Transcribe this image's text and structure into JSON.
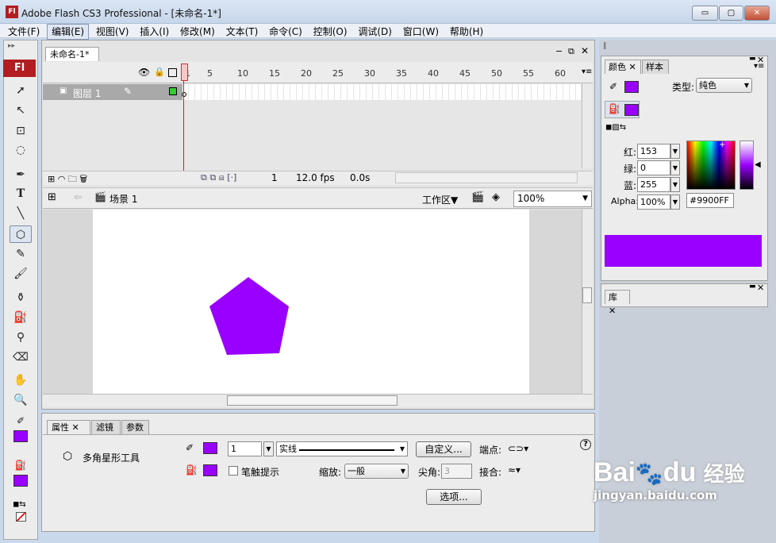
{
  "window": {
    "logo": "Fl",
    "title": "Adobe Flash CS3 Professional - [未命名-1*]",
    "min": "▭",
    "max": "▢",
    "close": "✕"
  },
  "menu": [
    "文件(F)",
    "编辑(E)",
    "视图(V)",
    "插入(I)",
    "修改(M)",
    "文本(T)",
    "命令(C)",
    "控制(O)",
    "调试(D)",
    "窗口(W)",
    "帮助(H)"
  ],
  "tools": {
    "logo": "Fl",
    "fill_color": "#9900ff",
    "stroke_color": "#9900ff"
  },
  "document": {
    "tab": "未命名-1*",
    "frame_numbers": [
      "1",
      "5",
      "10",
      "15",
      "20",
      "25",
      "30",
      "35",
      "40",
      "45",
      "50",
      "55",
      "60"
    ],
    "layer_name": "图层 1",
    "status": {
      "frame": "1",
      "fps": "12.0 fps",
      "time": "0.0s"
    },
    "scene": "场景 1",
    "workspace": "工作区▼",
    "zoom": "100%"
  },
  "properties": {
    "tabs": [
      "属性",
      "滤镜",
      "参数"
    ],
    "tool_name": "多角星形工具",
    "stroke_width": "1",
    "stroke_style": "实线",
    "custom_button": "自定义...",
    "endpoint_label": "端点:",
    "stroke_hint": "笔触提示",
    "scale_label": "缩放:",
    "scale_value": "一般",
    "miter_label": "尖角:",
    "miter_value": "3",
    "join_label": "接合:",
    "options_button": "选项...",
    "help": "?"
  },
  "color_panel": {
    "tabs": [
      "颜色",
      "样本"
    ],
    "type_label": "类型:",
    "type_value": "纯色",
    "red_label": "红:",
    "red": "153",
    "green_label": "绿:",
    "green": "0",
    "blue_label": "蓝:",
    "blue": "255",
    "alpha_label": "Alpha:",
    "alpha": "100%",
    "hex": "#9900FF",
    "color": "#9900ff"
  },
  "library_panel": {
    "tab": "库"
  },
  "watermark": {
    "brand": "Bai",
    "brand2": "du",
    "suffix": "经验",
    "url": "jingyan.baidu.com"
  }
}
